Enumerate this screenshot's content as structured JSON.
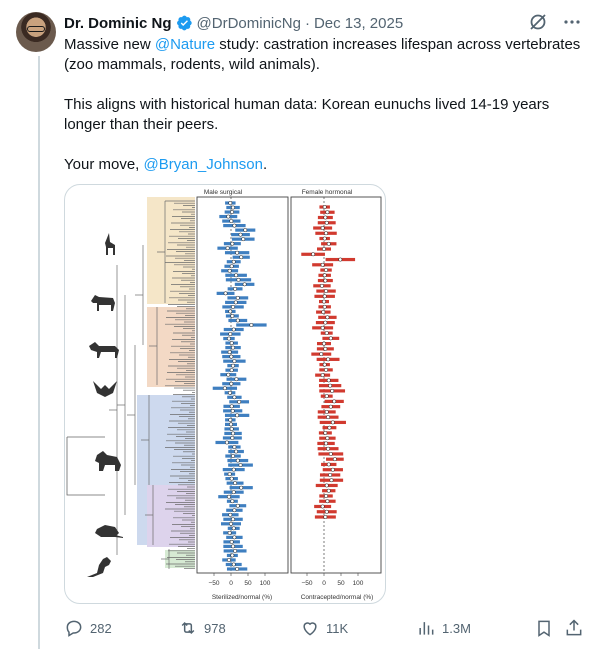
{
  "author": {
    "name": "Dr. Dominic Ng",
    "handle": "@DrDominicNg",
    "separator": "·",
    "date": "Dec 13, 2025",
    "verified_color": "#1d9bf0"
  },
  "tweet": {
    "line1_pre": "Massive new ",
    "line1_mention": "@Nature",
    "line1_post": " study: castration increases lifespan across vertebrates (zoo mammals, rodents, wild animals).",
    "line2": "This aligns with historical human data: Korean eunuchs lived 14-19 years longer than their peers.",
    "line3_pre": "Your move, ",
    "line3_mention": "@Bryan_Johnson",
    "line3_post": "."
  },
  "header_icons": [
    "grok-icon",
    "more-icon"
  ],
  "figure": {
    "panel_left_title": "Male surgical",
    "panel_right_title": "Female hormonal",
    "left_xlabel": "Sterilized/normal (%)",
    "right_xlabel": "Contracepted/normal (%)",
    "ticks": [
      "−50",
      "0",
      "50",
      "100"
    ],
    "male_color": "#3f7fc0",
    "female_color": "#d13a2f",
    "silhouettes": [
      "antelope-icon",
      "zebra-icon",
      "lion-icon",
      "bat-icon",
      "baboon-icon",
      "rat-icon",
      "kangaroo-icon"
    ]
  },
  "chart_data": [
    {
      "type": "scatter",
      "title": "Male surgical",
      "xlabel": "Sterilized/normal (%)",
      "xlim": [
        -60,
        110
      ],
      "xticks": [
        -50,
        0,
        50,
        100
      ],
      "series": [
        {
          "name": "Male surgical",
          "values": [
            -2,
            6,
            3,
            -8,
            1,
            10,
            42,
            28,
            36,
            4,
            -10,
            18,
            30,
            8,
            2,
            -4,
            15,
            22,
            40,
            12,
            -16,
            20,
            14,
            6,
            -2,
            4,
            20,
            60,
            8,
            -2,
            -6,
            2,
            6,
            -4,
            1,
            10,
            6,
            2,
            -8,
            16,
            1,
            -18,
            -3,
            10,
            24,
            2,
            5,
            18,
            -2,
            0,
            2,
            6,
            4,
            -12,
            10,
            15,
            6,
            20,
            28,
            8,
            -4,
            2,
            12,
            30,
            8,
            -6,
            4,
            20,
            10,
            -2,
            6,
            0,
            8,
            -4,
            10,
            2,
            6,
            12,
            4,
            -6,
            8,
            18
          ]
        }
      ]
    },
    {
      "type": "scatter",
      "title": "Female hormonal",
      "xlabel": "Contracepted/normal (%)",
      "xlim": [
        -60,
        110
      ],
      "xticks": [
        -50,
        0,
        50,
        100
      ],
      "series": [
        {
          "name": "Female hormonal",
          "values": [
            2,
            10,
            4,
            8,
            -4,
            6,
            2,
            14,
            0,
            -32,
            48,
            -4,
            6,
            2,
            4,
            -6,
            6,
            2,
            0,
            2,
            -2,
            10,
            4,
            -4,
            8,
            20,
            0,
            4,
            -8,
            12,
            2,
            6,
            -4,
            14,
            18,
            24,
            8,
            30,
            20,
            8,
            12,
            26,
            16,
            4,
            10,
            6,
            12,
            20,
            32,
            14,
            26,
            18,
            22,
            8,
            14,
            6,
            10,
            -4,
            8,
            4
          ]
        }
      ]
    }
  ],
  "stats": {
    "replies": "282",
    "reposts": "978",
    "likes": "11K",
    "views": "1.3M"
  }
}
